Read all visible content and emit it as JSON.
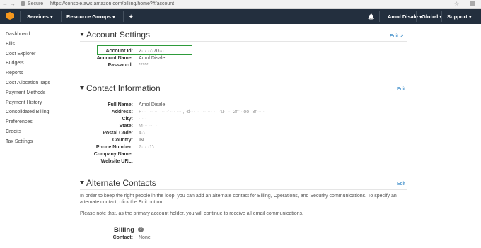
{
  "browser": {
    "back": "←",
    "forward": "→",
    "secure_label": "Secure",
    "url": "https://console.aws.amazon.com/billing/home?#/account",
    "star": "☆"
  },
  "topnav": {
    "services": "Services ▾",
    "resource_groups": "Resource Groups ▾",
    "pin": "✦",
    "bell": "🔔",
    "user": "Amol Disale ▾",
    "region": "Global ▾",
    "support": "Support ▾"
  },
  "sidebar": {
    "items": [
      {
        "label": "Dashboard"
      },
      {
        "label": "Bills"
      },
      {
        "label": "Cost Explorer"
      },
      {
        "label": "Budgets"
      },
      {
        "label": "Reports"
      },
      {
        "label": "Cost Allocation Tags"
      },
      {
        "label": "Payment Methods"
      },
      {
        "label": "Payment History"
      },
      {
        "label": "Consolidated Billing"
      },
      {
        "label": "Preferences"
      },
      {
        "label": "Credits"
      },
      {
        "label": "Tax Settings"
      }
    ]
  },
  "account_settings": {
    "title": "Account Settings",
    "edit": "Edit ↗",
    "fields": [
      {
        "label": "Account Id:",
        "value": "2··· ··'·70···"
      },
      {
        "label": "Account Name:",
        "value": "Amol Disale"
      },
      {
        "label": "Password:",
        "value": "*****"
      }
    ]
  },
  "contact_info": {
    "title": "Contact Information",
    "edit": "Edit",
    "fields": [
      {
        "label": "Full Name:",
        "value": "Amol Disale"
      },
      {
        "label": "Address:",
        "value": "F··· ··· ··' ··· ·' ··· ··· , ·d··· ·· ··· ··· ·· ·'u·· ·· 2n' ·loo· 3r··· ·"
      },
      {
        "label": "City:",
        "value": "··· ·"
      },
      {
        "label": "State:",
        "value": "M··· ··· ·"
      },
      {
        "label": "Postal Code:",
        "value": "4·'·"
      },
      {
        "label": "Country:",
        "value": "IN"
      },
      {
        "label": "Phone Number:",
        "value": "7··· ·1'·"
      },
      {
        "label": "Company Name:",
        "value": ""
      },
      {
        "label": "Website URL:",
        "value": ""
      }
    ]
  },
  "alternate_contacts": {
    "title": "Alternate Contacts",
    "edit": "Edit",
    "para1": "In order to keep the right people in the loop, you can add an alternate contact for Billing, Operations, and Security communications. To specify an alternate contact, click the Edit button.",
    "para2": "Please note that, as the primary account holder, you will continue to receive all email communications.",
    "billing_title": "Billing",
    "help_icon": "?",
    "contact_label": "Contact:",
    "contact_value": "None"
  }
}
